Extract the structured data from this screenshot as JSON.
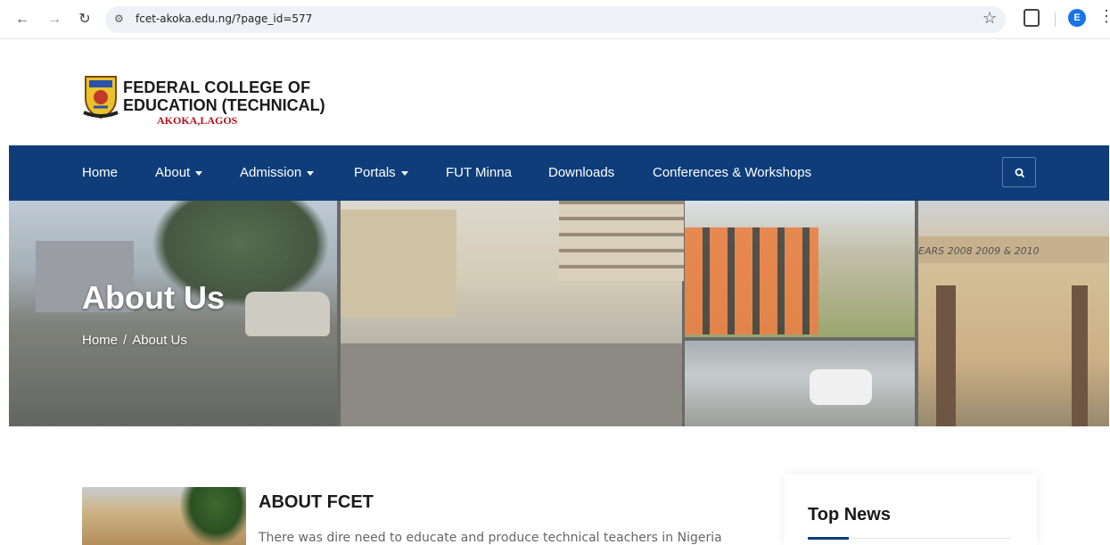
{
  "browser": {
    "url": "fcet-akoka.edu.ng/?page_id=577",
    "profile_initial": "E"
  },
  "header": {
    "logo_line1": "FEDERAL COLLEGE OF",
    "logo_line2": "EDUCATION (TECHNICAL)",
    "logo_line3": "AKOKA,LAGOS"
  },
  "nav": {
    "items": [
      {
        "label": "Home",
        "dropdown": false
      },
      {
        "label": "About",
        "dropdown": true
      },
      {
        "label": "Admission",
        "dropdown": true
      },
      {
        "label": "Portals",
        "dropdown": true
      },
      {
        "label": "FUT Minna",
        "dropdown": false
      },
      {
        "label": "Downloads",
        "dropdown": false
      },
      {
        "label": "Conferences & Workshops",
        "dropdown": false
      }
    ],
    "background": "#0e3d7a"
  },
  "hero": {
    "title": "About Us",
    "breadcrumb_home": "Home",
    "breadcrumb_separator": "/",
    "breadcrumb_current": "About Us",
    "photo_sign_text": "EARS 2008 2009 & 2010"
  },
  "content": {
    "heading": "ABOUT FCET",
    "intro": "There was dire need to educate and produce technical teachers in Nigeria"
  },
  "sidebar": {
    "title": "Top News"
  },
  "icons": [
    "back-icon",
    "forward-icon",
    "reload-icon",
    "site-info-icon",
    "star-icon",
    "extensions-icon",
    "menu-icon",
    "search-icon",
    "college-crest-icon"
  ]
}
